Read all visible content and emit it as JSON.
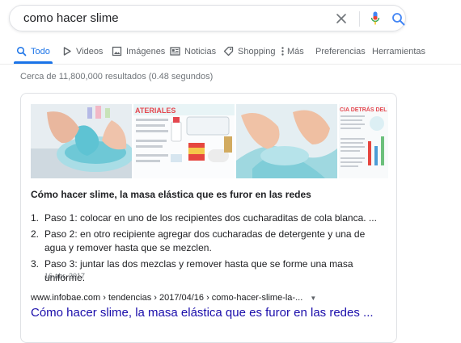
{
  "search": {
    "query": "como hacer slime"
  },
  "tabs": [
    {
      "label": "Todo",
      "icon": "search-icon",
      "active": true
    },
    {
      "label": "Videos",
      "icon": "video-icon"
    },
    {
      "label": "Imágenes",
      "icon": "image-icon"
    },
    {
      "label": "Noticias",
      "icon": "news-icon"
    },
    {
      "label": "Shopping",
      "icon": "tag-icon"
    },
    {
      "label": "Más",
      "icon": "more-vert-icon"
    },
    {
      "label": "Preferencias"
    },
    {
      "label": "Herramientas"
    }
  ],
  "result_stats": "Cerca de 11,800,000 resultados (0.48 segundos)",
  "featured": {
    "images": [
      {
        "alt": "slime-photo-hands-bowl"
      },
      {
        "alt": "materials-infographic",
        "text_top": "ATERIALES"
      },
      {
        "alt": "slime-photo-hands-spread"
      },
      {
        "alt": "science-infographic",
        "text_top": "CIA DETRÁS DEL SLIME"
      }
    ],
    "title": "Cómo hacer slime, la masa elástica que es furor en las redes",
    "steps": [
      {
        "num": "1.",
        "text": "Paso 1: colocar en uno de los recipientes dos cucharaditas de cola blanca. ..."
      },
      {
        "num": "2.",
        "text": "Paso 2: en otro recipiente agregar dos cucharadas de detergente y una de agua y remover hasta que se mezclen."
      },
      {
        "num": "3.",
        "text": "Paso 3: juntar las dos mezclas y remover hasta que se forme una masa uniforme."
      }
    ],
    "date": "16 abr. 2017",
    "url": "www.infobae.com › tendencias › 2017/04/16 › como-hacer-slime-la-...",
    "link": "Cómo hacer slime, la masa elástica que es furor en las redes ..."
  },
  "colors": {
    "accent": "#1a73e8",
    "link": "#1a0dab",
    "muted": "#70757a",
    "slime": "#8fd3dd",
    "mic_red": "#ea4335"
  }
}
